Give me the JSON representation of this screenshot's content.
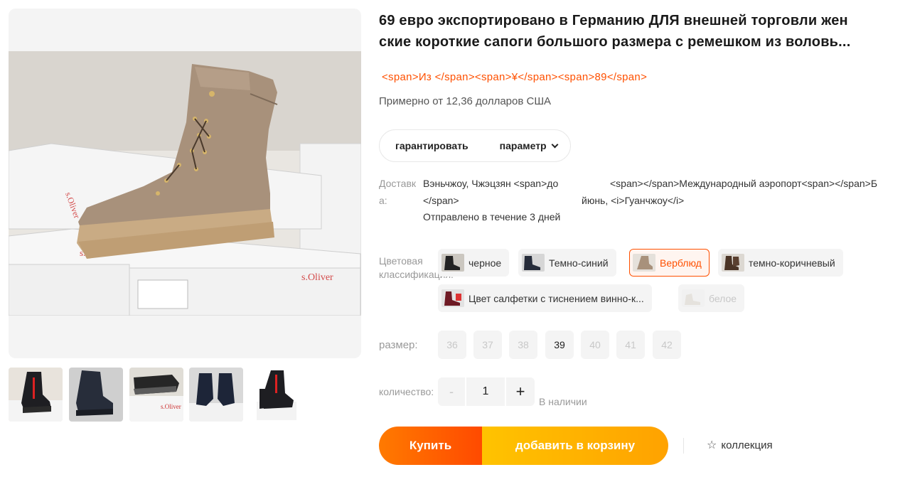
{
  "product": {
    "title_line1": "69 евро экспортировано в Германию ДЛЯ внешней торговли жен",
    "title_line2": "ские короткие сапоги большого размера с ремешком из воловь...",
    "price_raw": "<span>Из </span><span>¥</span><span>89</span>",
    "price_usd": "Примерно от 12,36 долларов США"
  },
  "tabs": {
    "guarantee": "гарантировать",
    "parameter": "параметр"
  },
  "delivery": {
    "label": "Доставка:",
    "from_line1": "Вэньчжоу, Чжэцзян <span>до",
    "from_line2": "</span>",
    "to_line1": "<span></span>Международный аэропорт<span></span>Б",
    "to_line2": "йюнь, <i>Гуанчжоу</i>",
    "ship_time": "Отправлено в течение 3 дней"
  },
  "colors": {
    "label": "Цветовая классификация:",
    "options": [
      {
        "label": "черное",
        "state": "normal",
        "icon": "boot-thumbnail-icon"
      },
      {
        "label": "Темно-синий",
        "state": "normal",
        "icon": "boot-thumbnail-icon"
      },
      {
        "label": "Верблюд",
        "state": "selected",
        "icon": "boot-thumbnail-icon"
      },
      {
        "label": "темно-коричневый",
        "state": "normal",
        "icon": "boot-thumbnail-icon"
      },
      {
        "label": "Цвет салфетки с тиснением винно-к...",
        "state": "normal",
        "icon": "boot-thumbnail-icon"
      },
      {
        "label": "белое",
        "state": "disabled",
        "icon": "boot-thumbnail-icon"
      }
    ]
  },
  "sizes": {
    "label": "размер:",
    "options": [
      "36",
      "37",
      "38",
      "39",
      "40",
      "41",
      "42"
    ],
    "available": [
      "39"
    ]
  },
  "quantity": {
    "label": "количество:",
    "minus": "-",
    "plus": "+",
    "value": "1",
    "stock": "В наличии"
  },
  "actions": {
    "buy": "Купить",
    "add_to_cart": "добавить в корзину",
    "collect": "коллекция"
  },
  "colors_theme": {
    "accent": "#ff5000",
    "buy_gradient_start": "#ff7a00",
    "cart_gradient_start": "#ffc300"
  }
}
